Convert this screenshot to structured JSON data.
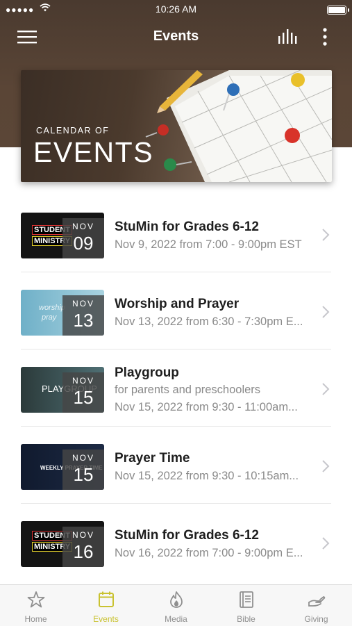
{
  "status_bar": {
    "signal": "●●●●●",
    "time": "10:26 AM"
  },
  "nav": {
    "title": "Events",
    "menu_icon": "hamburger-menu-icon",
    "stats_icon": "bar-chart-icon",
    "more_icon": "more-vertical-icon"
  },
  "banner": {
    "kicker": "CALENDAR OF",
    "headline": "EVENTS"
  },
  "events": [
    {
      "title": "StuMin for Grades 6-12",
      "subtitle": "",
      "when": "Nov 9, 2022 from 7:00 - 9:00pm EST",
      "month": "NOV",
      "day": "09",
      "art_text_1": "STUDENT",
      "art_text_2": "MINISTRY"
    },
    {
      "title": "Worship and Prayer",
      "subtitle": "",
      "when": "Nov 13, 2022 from 6:30 - 7:30pm E...",
      "month": "NOV",
      "day": "13",
      "art_text_1": "worship",
      "art_text_2": "pray"
    },
    {
      "title": "Playgroup",
      "subtitle": "for parents and preschoolers",
      "when": "Nov 15, 2022 from 9:30 - 11:00am...",
      "month": "NOV",
      "day": "15",
      "art_text_1": "PLAYGROUP",
      "art_text_2": ""
    },
    {
      "title": "Prayer Time",
      "subtitle": "",
      "when": "Nov 15, 2022 from 9:30 - 10:15am...",
      "month": "NOV",
      "day": "15",
      "art_text_1": "WEEKLY PRAYER TIME",
      "art_text_2": ""
    },
    {
      "title": "StuMin for Grades 6-12",
      "subtitle": "",
      "when": "Nov 16, 2022 from 7:00 - 9:00pm E...",
      "month": "NOV",
      "day": "16",
      "art_text_1": "STUDENT",
      "art_text_2": "MINISTRY"
    }
  ],
  "tabs": [
    {
      "label": "Home",
      "icon": "star-icon",
      "active": false
    },
    {
      "label": "Events",
      "icon": "calendar-icon",
      "active": true
    },
    {
      "label": "Media",
      "icon": "flame-icon",
      "active": false
    },
    {
      "label": "Bible",
      "icon": "book-icon",
      "active": false
    },
    {
      "label": "Giving",
      "icon": "giving-hand-icon",
      "active": false
    }
  ],
  "colors": {
    "header_brown": "#5a4536",
    "accent": "#c9c230",
    "inactive_tab": "#8f8f8f",
    "subtitle_gray": "#8a8a8a"
  }
}
